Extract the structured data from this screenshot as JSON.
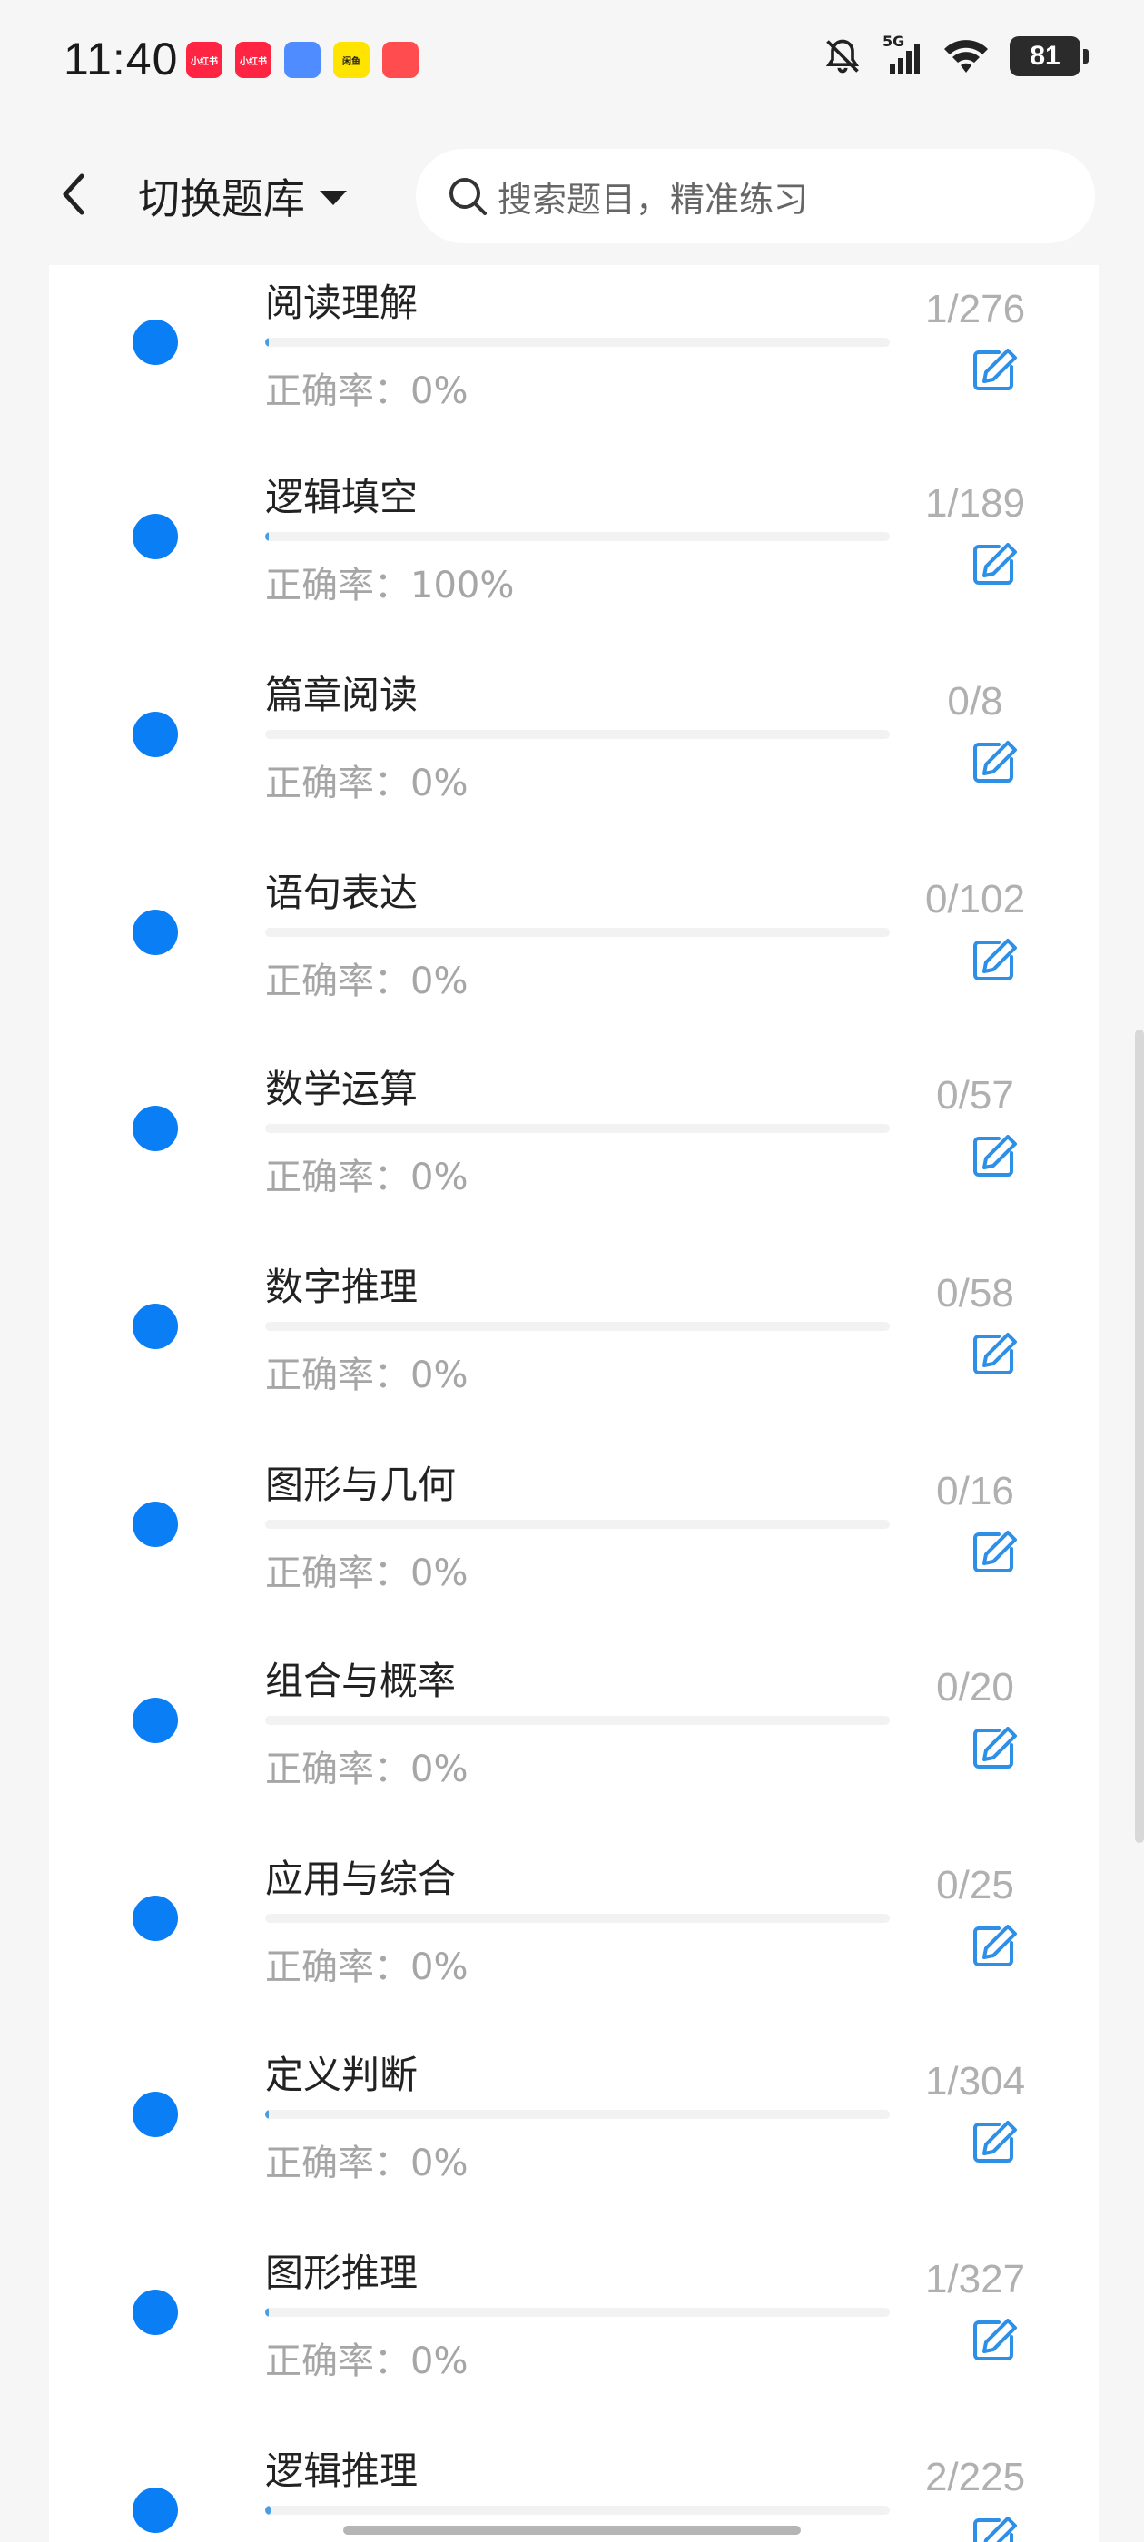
{
  "status_bar": {
    "time": "11:40",
    "apps": [
      {
        "name": "xiaohongshu-icon",
        "label": "小红书",
        "color": "#ff2442"
      },
      {
        "name": "xiaohongshu-icon",
        "label": "小红书",
        "color": "#ff2442"
      },
      {
        "name": "molecule-app-icon",
        "label": "",
        "color": "#4e8cff"
      },
      {
        "name": "yellow-app-icon",
        "label": "闲鱼",
        "color": "#ffe400"
      },
      {
        "name": "red-triangle-app-icon",
        "label": "",
        "color": "#ff4d4f"
      }
    ],
    "network": "5G",
    "battery": "81"
  },
  "header": {
    "title": "切换题库",
    "search_placeholder": "搜索题目，精准练习"
  },
  "accuracy_prefix": "正确率：",
  "accent_color": "#0a7ef5",
  "items": [
    {
      "title": "阅读理解",
      "accuracy": "正确率：0%",
      "count": "1/276",
      "progress": 0.0036
    },
    {
      "title": "逻辑填空",
      "accuracy": "正确率：100%",
      "count": "1/189",
      "progress": 0.0053
    },
    {
      "title": "篇章阅读",
      "accuracy": "正确率：0%",
      "count": "0/8",
      "progress": 0
    },
    {
      "title": "语句表达",
      "accuracy": "正确率：0%",
      "count": "0/102",
      "progress": 0
    },
    {
      "title": "数学运算",
      "accuracy": "正确率：0%",
      "count": "0/57",
      "progress": 0
    },
    {
      "title": "数字推理",
      "accuracy": "正确率：0%",
      "count": "0/58",
      "progress": 0
    },
    {
      "title": "图形与几何",
      "accuracy": "正确率：0%",
      "count": "0/16",
      "progress": 0
    },
    {
      "title": "组合与概率",
      "accuracy": "正确率：0%",
      "count": "0/20",
      "progress": 0
    },
    {
      "title": "应用与综合",
      "accuracy": "正确率：0%",
      "count": "0/25",
      "progress": 0
    },
    {
      "title": "定义判断",
      "accuracy": "正确率：0%",
      "count": "1/304",
      "progress": 0.0033
    },
    {
      "title": "图形推理",
      "accuracy": "正确率：0%",
      "count": "1/327",
      "progress": 0.0031
    },
    {
      "title": "逻辑推理",
      "accuracy": "",
      "count": "2/225",
      "progress": 0.0089
    }
  ]
}
